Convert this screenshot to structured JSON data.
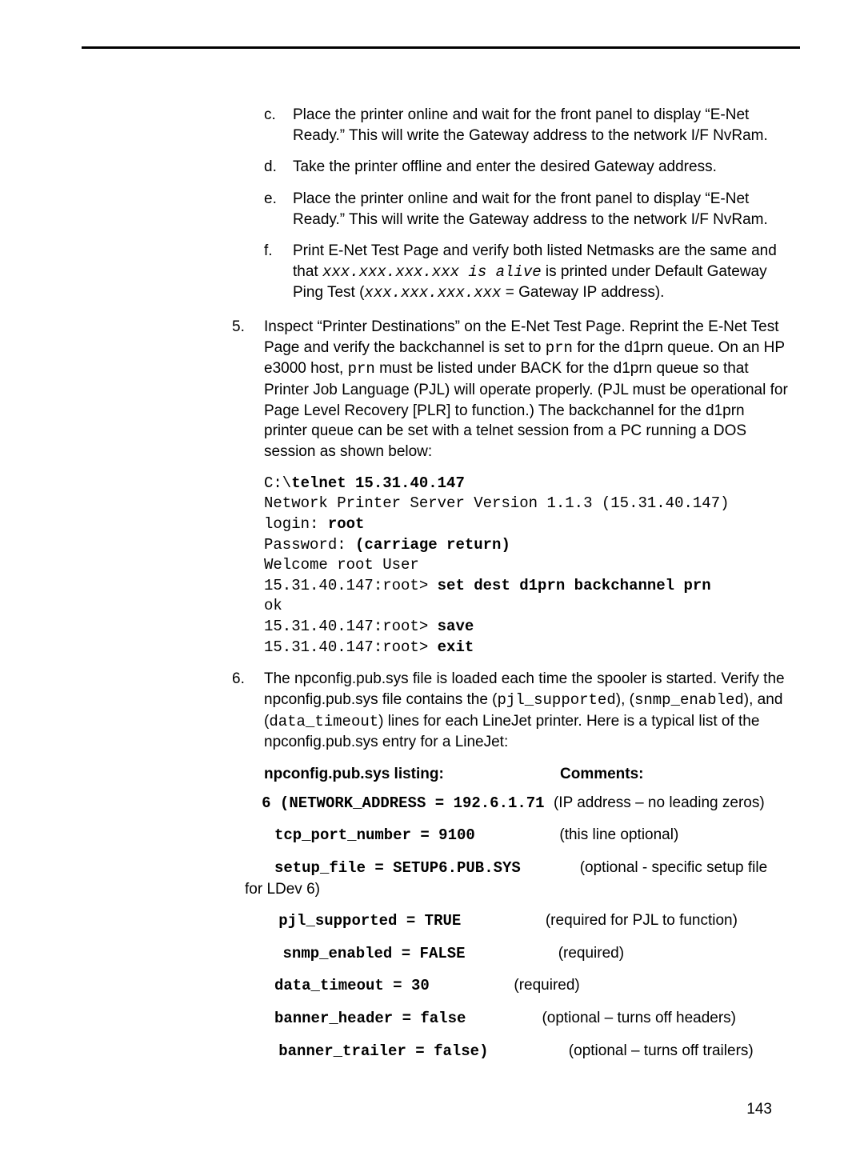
{
  "sublist": {
    "c": {
      "m": "c.",
      "t": "Place the printer online and wait for the front panel to display “E-Net Ready.” This will write the Gateway address to the network I/F NvRam."
    },
    "d": {
      "m": "d.",
      "t": "Take the printer offline and enter the desired Gateway address."
    },
    "e": {
      "m": "e.",
      "t": "Place the printer online and wait for the front panel to display “E-Net Ready.” This will write the Gateway address to the network I/F NvRam."
    },
    "f": {
      "m": "f.",
      "t1": "Print E-Net Test Page and verify both listed Netmasks are the same and that ",
      "code1": "xxx.xxx.xxx.xxx is alive",
      "t2": " is printed under Default Gateway Ping Test (",
      "code2": "xxx.xxx.xxx.xxx",
      "t3": " = Gateway IP address)."
    }
  },
  "step5": {
    "m": "5.",
    "t1": "Inspect “Printer Destinations” on the E-Net Test Page. Reprint the E-Net Test Page and verify the backchannel is set to ",
    "c1": "prn",
    "t2": " for the d1prn queue. On an HP e3000 host, ",
    "c2": "prn",
    "t3": " must be listed under BACK for the d1prn queue so that Printer Job Language (PJL) will operate properly. (PJL must be operational for Page Level Recovery [PLR] to function.) The backchannel for the d1prn printer queue can be set with a telnet session from a PC running a DOS session as shown below:"
  },
  "telnet": {
    "l1a": "C:\\",
    "l1b": "telnet 15.31.40.147",
    "l2": "Network Printer Server Version 1.1.3 (15.31.40.147)",
    "l3a": "login: ",
    "l3b": "root",
    "l4a": "Password: ",
    "l4b": "(carriage return)",
    "l5": "Welcome root User",
    "l6a": "15.31.40.147:root> ",
    "l6b": "set dest d1prn backchannel prn",
    "l7": "ok",
    "l8a": "15.31.40.147:root> ",
    "l8b": "save",
    "l9a": "15.31.40.147:root> ",
    "l9b": "exit"
  },
  "step6": {
    "m": "6.",
    "t1": "The npconfig.pub.sys file is loaded each time the spooler is started. Verify the npconfig.pub.sys file contains the (",
    "c1": "pjl_supported",
    "t2": "), (",
    "c2": "snmp_enabled",
    "t3": "), and (",
    "c3": "data_timeout",
    "t4": ") lines for each LineJet printer. Here is a typical list of the npconfig.pub.sys entry for a LineJet:"
  },
  "hdr": {
    "left": "npconfig.pub.sys listing:",
    "right": "Comments:"
  },
  "cfg": {
    "net": {
      "pad": "    ",
      "key": "6 (NETWORK_ADDRESS = 192.6.1.71 ",
      "cmt": "(IP address – no leading zeros)"
    },
    "tcp": {
      "pad": "       ",
      "key": "tcp_port_number = 9100",
      "gap": "                    ",
      "cmt": "(this line optional)"
    },
    "setup": {
      "pad": "       ",
      "key": "setup_file = SETUP6.PUB.SYS",
      "gap": "              ",
      "cmt": "(optional - specific setup file for LDev 6)"
    },
    "pjl": {
      "pad": "        ",
      "key": "pjl_supported = TRUE",
      "gap": "                    ",
      "cmt": "(required for PJL to function)"
    },
    "snmp": {
      "pad": "         ",
      "key": "snmp_enabled = FALSE",
      "gap": "                      ",
      "cmt": "(required)"
    },
    "data": {
      "pad": "       ",
      "key": "data_timeout = 30",
      "gap": "                    ",
      "cmt": "(required)"
    },
    "bhdr": {
      "pad": "       ",
      "key": "banner_header = false",
      "gap": "                  ",
      "cmt": "(optional – turns off headers)"
    },
    "btrl": {
      "pad": "        ",
      "key": "banner_trailer = false)",
      "gap": "                   ",
      "cmt": "(optional – turns off trailers)"
    }
  },
  "pageno": "143"
}
